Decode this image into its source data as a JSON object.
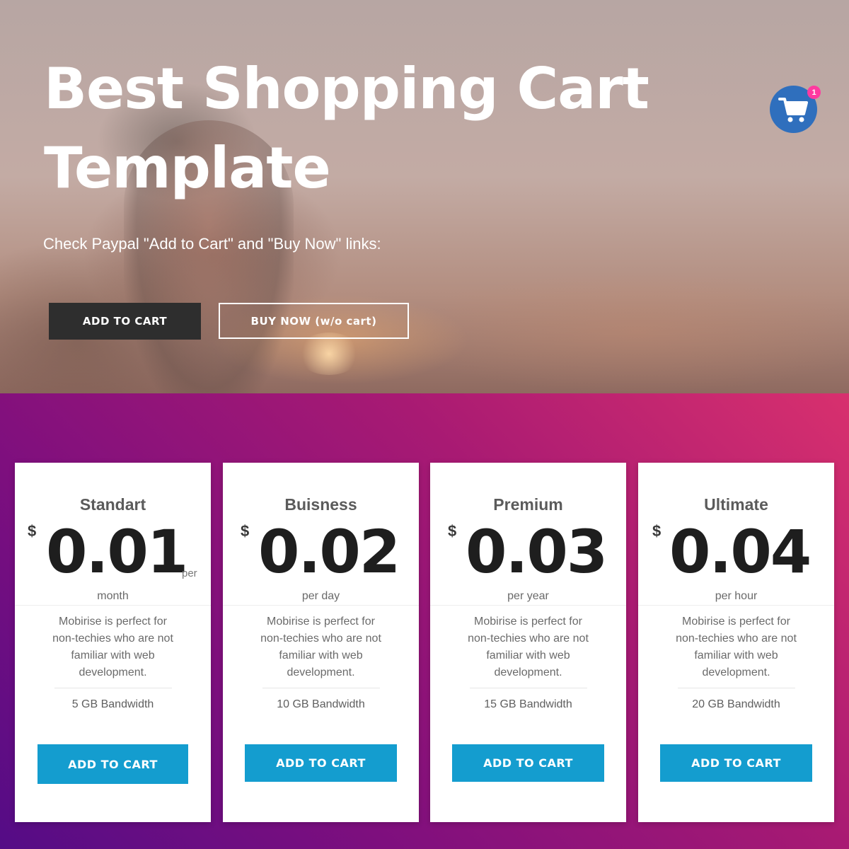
{
  "hero": {
    "title_line1": "Best Shopping Cart",
    "title_line2": "Template",
    "subtitle": "Check Paypal \"Add to Cart\" and \"Buy Now\" links:",
    "add_to_cart_label": "ADD TO CART",
    "buy_now_label": "BUY NOW (w/o cart)"
  },
  "cart": {
    "icon": "shopping-cart-icon",
    "badge_count": "1",
    "color": "#2f6fbd",
    "badge_color": "#ff3aa0"
  },
  "pricing": {
    "plans": [
      {
        "name": "Standart",
        "currency": "$",
        "amount": "0.01",
        "per": "per",
        "period": "month",
        "description": "Mobirise is perfect for non-techies who are not familiar with web development.",
        "bandwidth": "5 GB Bandwidth",
        "button_label": "ADD TO CART"
      },
      {
        "name": "Buisness",
        "currency": "$",
        "amount": "0.02",
        "period": "per day",
        "description": "Mobirise is perfect for non-techies who are not familiar with web development.",
        "bandwidth": "10 GB Bandwidth",
        "button_label": "ADD TO CART"
      },
      {
        "name": "Premium",
        "currency": "$",
        "amount": "0.03",
        "period": "per year",
        "description": "Mobirise is perfect for non-techies who are not familiar with web development.",
        "bandwidth": "15 GB Bandwidth",
        "button_label": "ADD TO CART"
      },
      {
        "name": "Ultimate",
        "currency": "$",
        "amount": "0.04",
        "period": "per hour",
        "description": "Mobirise is perfect for non-techies who are not familiar with web development.",
        "bandwidth": "20 GB Bandwidth",
        "button_label": "ADD TO CART"
      }
    ],
    "accent_color": "#149dcf"
  }
}
